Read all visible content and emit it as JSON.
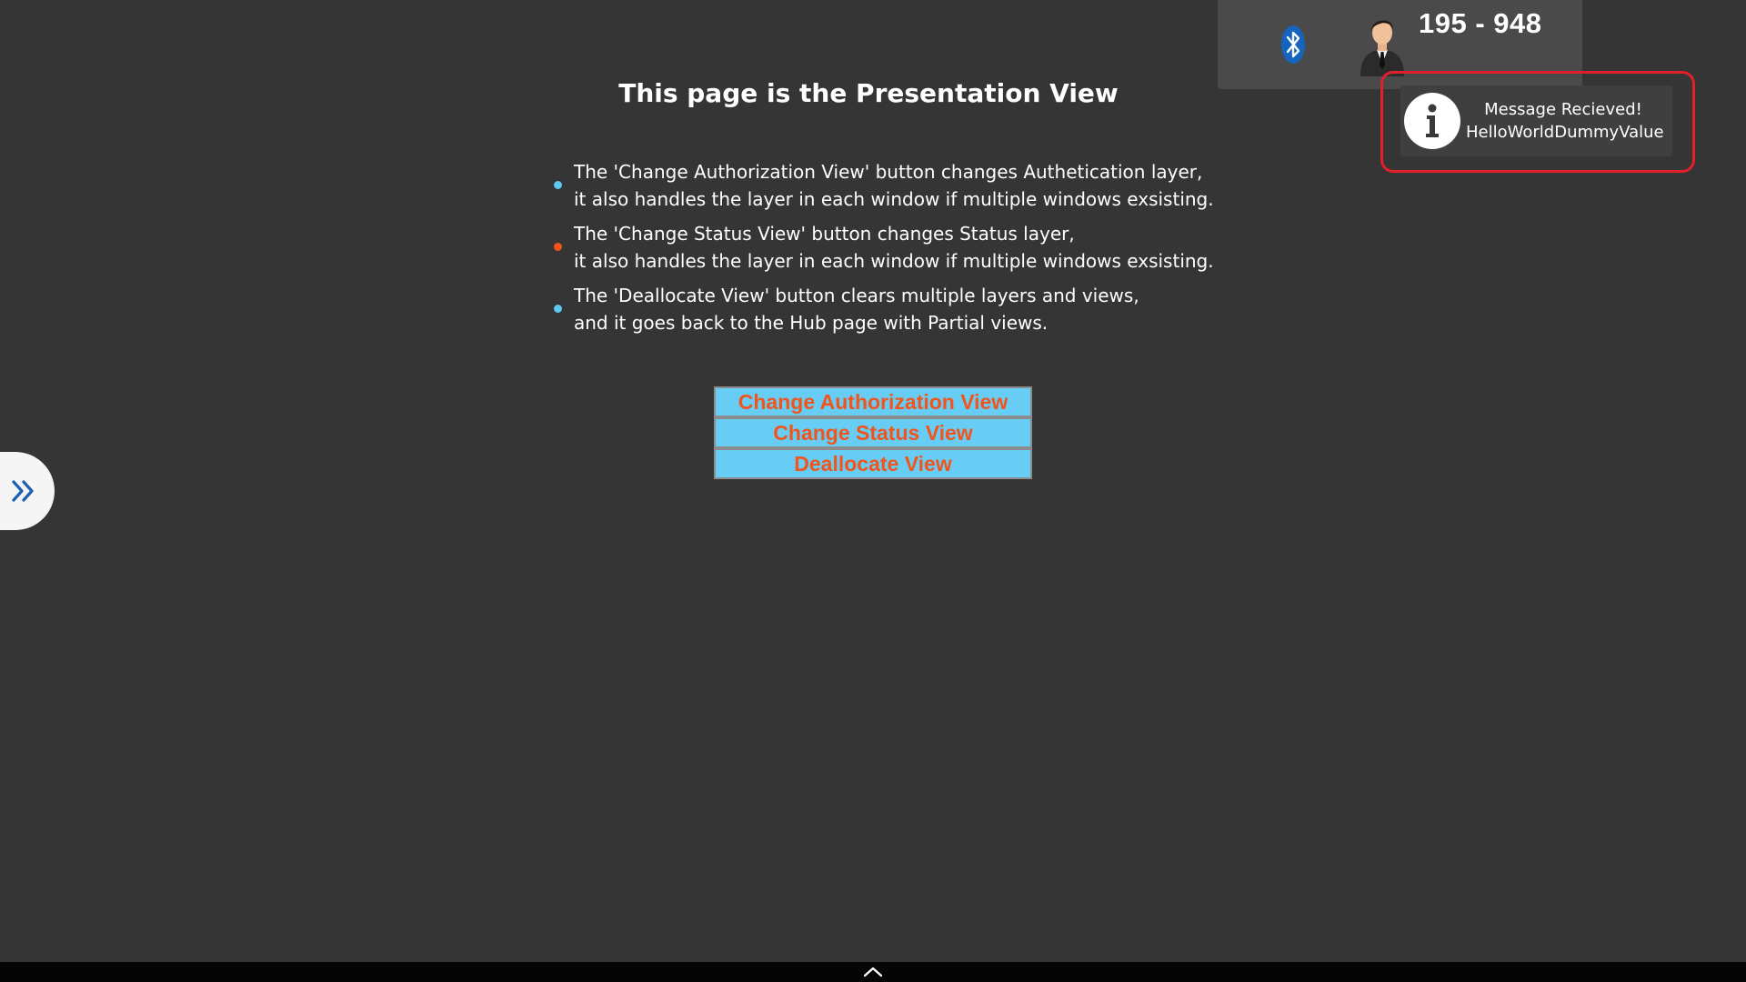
{
  "header": {
    "session_id": "195 - 948",
    "bluetooth_icon": "bluetooth-icon",
    "user_icon": "user-avatar-icon"
  },
  "toast": {
    "icon": "info-icon",
    "title": "Message Recieved!",
    "message": "HelloWorldDummyValue",
    "highlight_color": "#e0202a"
  },
  "main": {
    "title": "This page is the Presentation View",
    "bullets": [
      {
        "line1": "The 'Change Authorization View' button changes Authetication layer,",
        "line2": "it also handles the layer in each window if multiple windows exsisting.",
        "dot_color": "#5ec8f2"
      },
      {
        "line1": "The 'Change Status View' button changes Status layer,",
        "line2": "it also handles the layer in each window if multiple windows exsisting.",
        "dot_color": "#f2541b"
      },
      {
        "line1": "The 'Deallocate View' button clears multiple layers and views,",
        "line2": "and it goes back to the Hub page with Partial views.",
        "dot_color": "#5ec8f2"
      }
    ],
    "buttons": {
      "change_authorization": "Change Authorization View",
      "change_status": "Change Status View",
      "deallocate": "Deallocate View"
    }
  },
  "side_handle": {
    "icon": "double-chevron-right-icon"
  },
  "bottom_bar": {
    "icon": "chevron-up-icon"
  },
  "colors": {
    "background": "#353535",
    "panel": "#4a4a4a",
    "button_fill": "#67cdf5",
    "button_text": "#f2541b",
    "accent_blue": "#5ec8f2",
    "accent_orange": "#f2541b"
  }
}
